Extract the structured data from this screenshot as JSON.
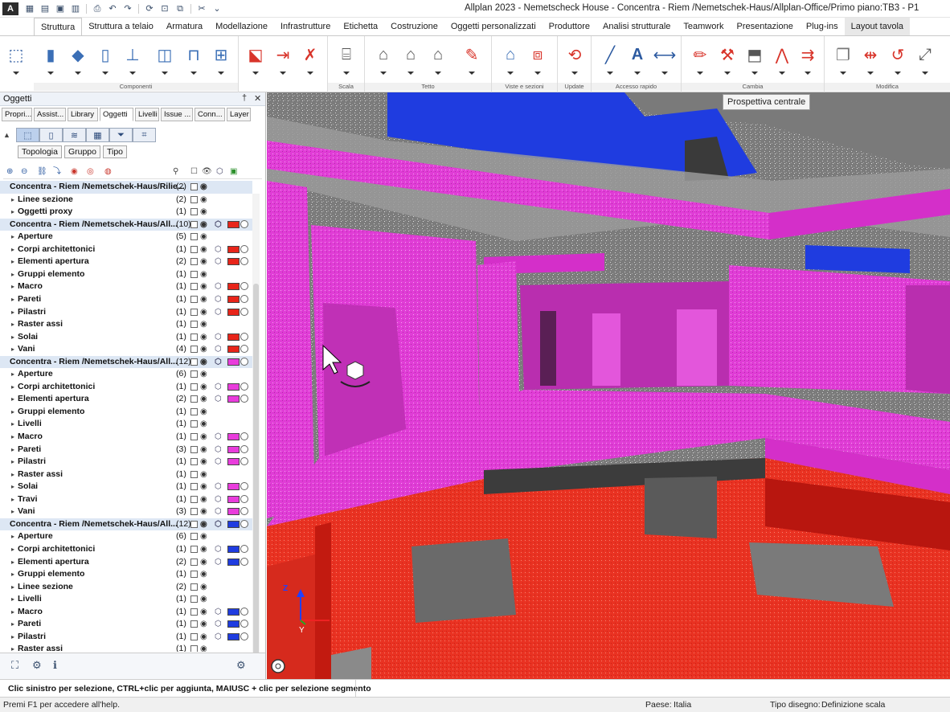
{
  "app": {
    "logo_letter": "A",
    "window_title": "Allplan 2023 - Nemetscheck House - Concentra - Riem /Nemetschek-Haus/Allplan-Office/Primo piano:TB3 - P1"
  },
  "ribbon_tabs": [
    "Struttura",
    "Struttura a telaio",
    "Armatura",
    "Modellazione",
    "Infrastrutture",
    "Etichetta",
    "Costruzione",
    "Oggetti personalizzati",
    "Produttore",
    "Analisi strutturale",
    "Teamwork",
    "Presentazione",
    "Plug-ins",
    "Layout tavola"
  ],
  "ribbon_groups": [
    "Componenti",
    "Scala",
    "Tetto",
    "Viste e sezioni",
    "Update",
    "Accesso rapido",
    "Cambia",
    "Modifica"
  ],
  "palette": {
    "title": "Oggetti",
    "pin": "†",
    "close": "✕",
    "tabs": [
      "Propri...",
      "Assist...",
      "Library",
      "Oggetti",
      "Livelli",
      "Issue ...",
      "Conn...",
      "Layer"
    ],
    "active_tab": "Oggetti",
    "filters": [
      "Topologia",
      "Gruppo",
      "Tipo"
    ]
  },
  "tree": [
    {
      "label": "Concentra - Riem /Nemetschek-Haus/Rilie...",
      "count": "(2)",
      "level": 0,
      "color": null
    },
    {
      "label": "Linee sezione",
      "count": "(2)",
      "level": 1,
      "color": null
    },
    {
      "label": "Oggetti proxy",
      "count": "(1)",
      "level": 1,
      "color": null
    },
    {
      "label": "Concentra - Riem /Nemetschek-Haus/All...",
      "count": "(10)",
      "level": 0,
      "color": "#e8251a"
    },
    {
      "label": "Aperture",
      "count": "(5)",
      "level": 1,
      "color": null
    },
    {
      "label": "Corpi architettonici",
      "count": "(1)",
      "level": 1,
      "color": "#e8251a"
    },
    {
      "label": "Elementi apertura",
      "count": "(2)",
      "level": 1,
      "color": "#e8251a"
    },
    {
      "label": "Gruppi elemento",
      "count": "(1)",
      "level": 1,
      "color": null
    },
    {
      "label": "Macro",
      "count": "(1)",
      "level": 1,
      "color": "#e8251a"
    },
    {
      "label": "Pareti",
      "count": "(1)",
      "level": 1,
      "color": "#e8251a"
    },
    {
      "label": "Pilastri",
      "count": "(1)",
      "level": 1,
      "color": "#e8251a"
    },
    {
      "label": "Raster assi",
      "count": "(1)",
      "level": 1,
      "color": null
    },
    {
      "label": "Solai",
      "count": "(1)",
      "level": 1,
      "color": "#e8251a"
    },
    {
      "label": "Vani",
      "count": "(4)",
      "level": 1,
      "color": "#e8251a"
    },
    {
      "label": "Concentra - Riem /Nemetschek-Haus/All...",
      "count": "(12)",
      "level": 0,
      "color": "#e93cdc"
    },
    {
      "label": "Aperture",
      "count": "(6)",
      "level": 1,
      "color": null
    },
    {
      "label": "Corpi architettonici",
      "count": "(1)",
      "level": 1,
      "color": "#e93cdc"
    },
    {
      "label": "Elementi apertura",
      "count": "(2)",
      "level": 1,
      "color": "#e93cdc"
    },
    {
      "label": "Gruppi elemento",
      "count": "(1)",
      "level": 1,
      "color": null
    },
    {
      "label": "Livelli",
      "count": "(1)",
      "level": 1,
      "color": null
    },
    {
      "label": "Macro",
      "count": "(1)",
      "level": 1,
      "color": "#e93cdc"
    },
    {
      "label": "Pareti",
      "count": "(3)",
      "level": 1,
      "color": "#e93cdc"
    },
    {
      "label": "Pilastri",
      "count": "(1)",
      "level": 1,
      "color": "#e93cdc"
    },
    {
      "label": "Raster assi",
      "count": "(1)",
      "level": 1,
      "color": null
    },
    {
      "label": "Solai",
      "count": "(1)",
      "level": 1,
      "color": "#e93cdc"
    },
    {
      "label": "Travi",
      "count": "(1)",
      "level": 1,
      "color": "#e93cdc"
    },
    {
      "label": "Vani",
      "count": "(3)",
      "level": 1,
      "color": "#e93cdc"
    },
    {
      "label": "Concentra - Riem /Nemetschek-Haus/All...",
      "count": "(12)",
      "level": 0,
      "color": "#1f3ce0"
    },
    {
      "label": "Aperture",
      "count": "(6)",
      "level": 1,
      "color": null
    },
    {
      "label": "Corpi architettonici",
      "count": "(1)",
      "level": 1,
      "color": "#1f3ce0"
    },
    {
      "label": "Elementi apertura",
      "count": "(2)",
      "level": 1,
      "color": "#1f3ce0"
    },
    {
      "label": "Gruppi elemento",
      "count": "(1)",
      "level": 1,
      "color": null
    },
    {
      "label": "Linee sezione",
      "count": "(2)",
      "level": 1,
      "color": null
    },
    {
      "label": "Livelli",
      "count": "(1)",
      "level": 1,
      "color": null
    },
    {
      "label": "Macro",
      "count": "(1)",
      "level": 1,
      "color": "#1f3ce0"
    },
    {
      "label": "Pareti",
      "count": "(1)",
      "level": 1,
      "color": "#1f3ce0"
    },
    {
      "label": "Pilastri",
      "count": "(1)",
      "level": 1,
      "color": "#1f3ce0"
    },
    {
      "label": "Raster assi",
      "count": "(1)",
      "level": 1,
      "color": null
    }
  ],
  "viewport": {
    "tooltip": "Prospettiva centrale",
    "axis_z": "Z",
    "axis_y": "Y"
  },
  "status": {
    "message": "Clic sinistro per selezione, CTRL+clic per aggiunta, MAIUSC + clic per selezione segmento",
    "help": "Premi F1 per accedere all'help.",
    "country_label": "Paese:",
    "country": "Italia",
    "drawing_type_label": "Tipo disegno:",
    "drawing_type": "Definizione scala"
  },
  "colors": {
    "accent": "#2c5aa0",
    "red_layer": "#e8251a",
    "magenta_layer": "#e93cdc",
    "blue_layer": "#1f3ce0"
  }
}
